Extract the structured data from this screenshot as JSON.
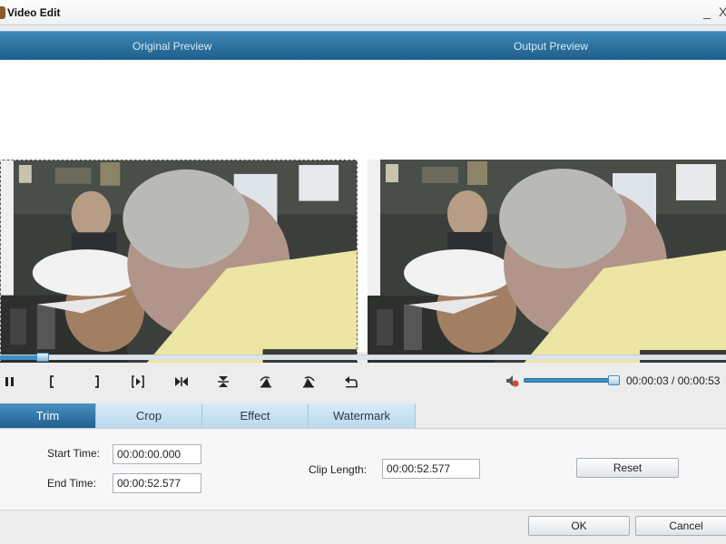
{
  "window": {
    "title": "Video Edit",
    "minimize_glyph": "_",
    "close_glyph": "X"
  },
  "preview": {
    "original_label": "Original Preview",
    "output_label": "Output Preview"
  },
  "player": {
    "seek_progress": 0.06,
    "volume_level": 0.9,
    "time_display": "00:00:03 / 00:00:53",
    "controls": [
      {
        "name": "pause-icon",
        "glyph": "pause"
      },
      {
        "name": "mark-in-icon",
        "glyph": "["
      },
      {
        "name": "mark-out-icon",
        "glyph": "]"
      },
      {
        "name": "play-segment-icon",
        "glyph": "[>]"
      },
      {
        "name": "step-frame-icon",
        "glyph": ">|<"
      },
      {
        "name": "flip-vertical-icon",
        "glyph": "flip-v"
      },
      {
        "name": "rotate-left-icon",
        "glyph": "rotate-l"
      },
      {
        "name": "rotate-right-icon",
        "glyph": "rotate-r"
      },
      {
        "name": "undo-icon",
        "glyph": "undo"
      }
    ]
  },
  "tabs": [
    "Trim",
    "Crop",
    "Effect",
    "Watermark"
  ],
  "active_tab": "Trim",
  "trim": {
    "start_label": "Start Time:",
    "start_value": "00:00:00.000",
    "end_label": "End Time:",
    "end_value": "00:00:52.577",
    "clip_label": "Clip Length:",
    "clip_value": "00:00:52.577",
    "reset_label": "Reset"
  },
  "footer": {
    "ok_label": "OK",
    "cancel_label": "Cancel"
  },
  "colors": {
    "accent": "#2a6fa3",
    "header_bar": "#2b6f9c",
    "active_tab": "#2f74a8",
    "inactive_tab": "#c9e1f3"
  }
}
